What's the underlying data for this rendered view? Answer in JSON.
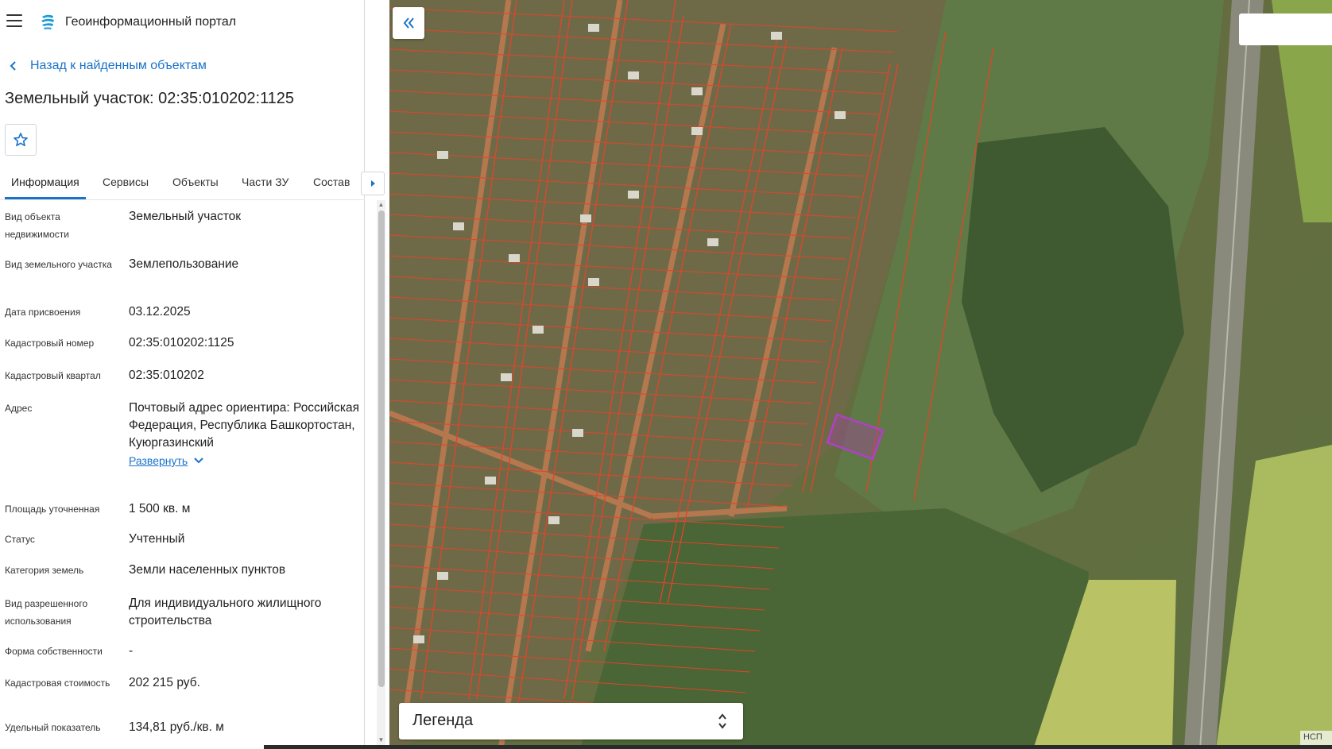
{
  "app": {
    "title": "Геоинформационный портал"
  },
  "nav": {
    "back_label": "Назад к найденным объектам"
  },
  "object": {
    "title": "Земельный участок: 02:35:010202:1125"
  },
  "tabs": [
    {
      "label": "Информация",
      "active": true
    },
    {
      "label": "Сервисы",
      "active": false
    },
    {
      "label": "Объекты",
      "active": false
    },
    {
      "label": "Части ЗУ",
      "active": false
    },
    {
      "label": "Состав",
      "active": false
    }
  ],
  "info": [
    {
      "label": "Вид объекта недвижимости",
      "value": "Земельный участок"
    },
    {
      "label": "Вид земельного участка",
      "value": "Землепользование"
    },
    {
      "label": "Дата присвоения",
      "value": "03.12.2025"
    },
    {
      "label": "Кадастровый номер",
      "value": "02:35:010202:1125"
    },
    {
      "label": "Кадастровый квартал",
      "value": "02:35:010202"
    },
    {
      "label": "Адрес",
      "value": "Почтовый адрес ориентира: Российская Федерация, Республика Башкортостан, Куюргазинский",
      "expand": "Развернуть"
    },
    {
      "label": "Площадь уточненная",
      "value": "1 500 кв. м"
    },
    {
      "label": "Статус",
      "value": "Учтенный"
    },
    {
      "label": "Категория земель",
      "value": "Земли населенных пунктов"
    },
    {
      "label": "Вид разрешенного использования",
      "value": "Для индивидуального жилищного строительства"
    },
    {
      "label": "Форма собственности",
      "value": "-"
    },
    {
      "label": "Кадастровая стоимость",
      "value": "202 215 руб."
    },
    {
      "label": "Удельный показатель",
      "value": "134,81 руб./кв. м"
    }
  ],
  "map": {
    "legend_label": "Легенда",
    "copyright": "НСП"
  },
  "colors": {
    "accent": "#1a73c9",
    "parcel_border": "#e0452a",
    "selected_parcel": "#b040c8"
  }
}
